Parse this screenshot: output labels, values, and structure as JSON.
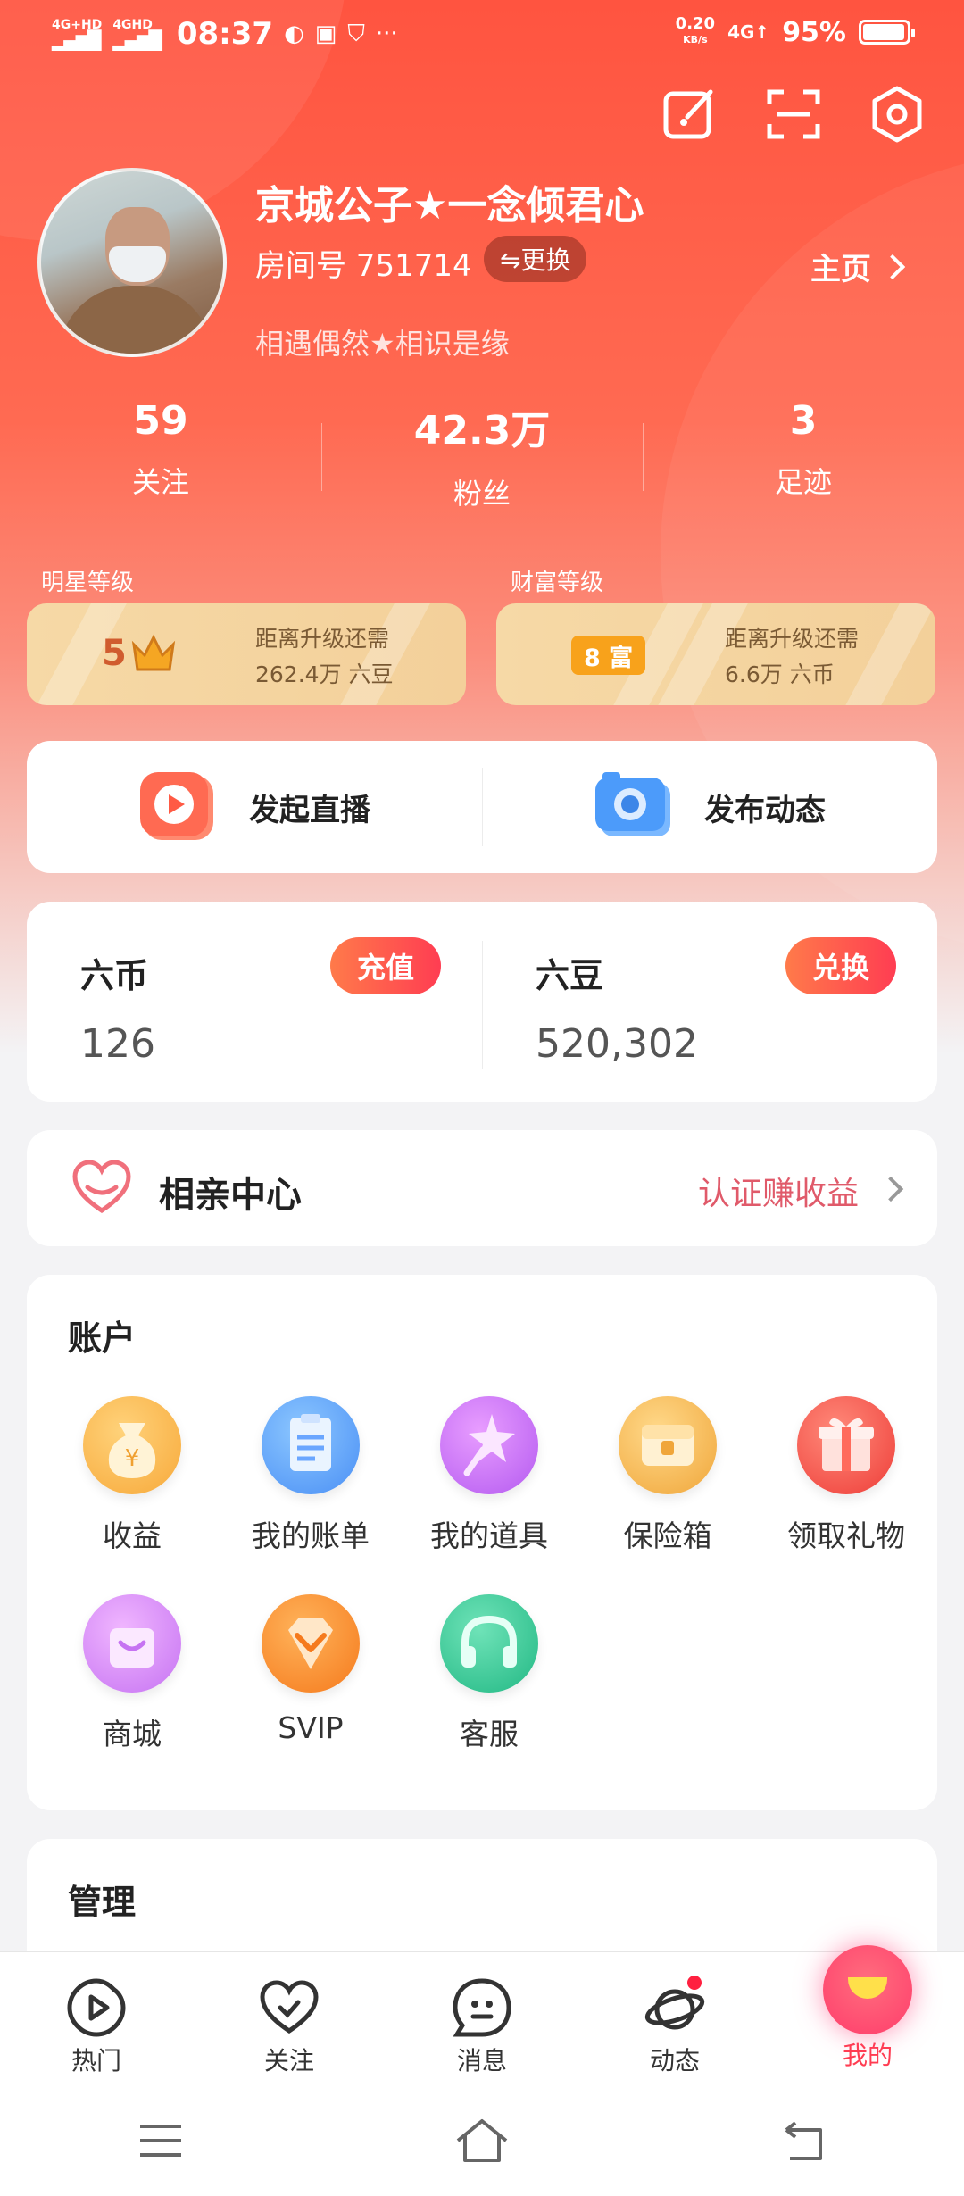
{
  "status_bar": {
    "sig1": "4G+HD",
    "sig2": "4GHD",
    "time": "08:37",
    "speed": "0.20",
    "speed_unit": "KB/s",
    "net": "4G↑",
    "battery_pct": "95%",
    "battery_level": 0.95,
    "more": "···"
  },
  "profile": {
    "name": "京城公子★一念倾君心",
    "room": "房间号 751714",
    "swap_label": "⇋更换",
    "homepage_label": "主页",
    "motto": "相遇偶然★相识是缘"
  },
  "stats": [
    {
      "num": "59",
      "label": "关注"
    },
    {
      "num": "42.3万",
      "label": "粉丝"
    },
    {
      "num": "3",
      "label": "足迹"
    }
  ],
  "levels": {
    "star": {
      "title": "明星等级",
      "level": "5",
      "line1": "距离升级还需",
      "line2": "262.4万 六豆"
    },
    "wealth": {
      "title": "财富等级",
      "badge": "8 富",
      "line1": "距离升级还需",
      "line2": "6.6万 六币"
    }
  },
  "actions": {
    "live": "发起直播",
    "post": "发布动态"
  },
  "wallet": {
    "coin": {
      "title": "六币",
      "value": "126",
      "button": "充值"
    },
    "bean": {
      "title": "六豆",
      "value": "520,302",
      "button": "兑换"
    }
  },
  "dating": {
    "title": "相亲中心",
    "cta": "认证赚收益"
  },
  "account": {
    "title": "账户",
    "items": [
      {
        "label": "收益",
        "icon": "money-bag-icon"
      },
      {
        "label": "我的账单",
        "icon": "bill-icon"
      },
      {
        "label": "我的道具",
        "icon": "wand-icon"
      },
      {
        "label": "保险箱",
        "icon": "safe-icon"
      },
      {
        "label": "领取礼物",
        "icon": "gift-icon"
      },
      {
        "label": "商城",
        "icon": "shopping-bag-icon"
      },
      {
        "label": "SVIP",
        "icon": "diamond-icon"
      },
      {
        "label": "客服",
        "icon": "headset-icon"
      }
    ]
  },
  "manage": {
    "title": "管理"
  },
  "tabs": [
    {
      "label": "热门",
      "icon": "play-icon"
    },
    {
      "label": "关注",
      "icon": "heart-icon"
    },
    {
      "label": "消息",
      "icon": "chat-icon"
    },
    {
      "label": "动态",
      "icon": "planet-icon"
    },
    {
      "label": "我的",
      "icon": "mine-icon"
    }
  ],
  "colors": {
    "accent": "#ff3d52",
    "hero": "#ff5440",
    "gold": "#f6d9a6"
  }
}
